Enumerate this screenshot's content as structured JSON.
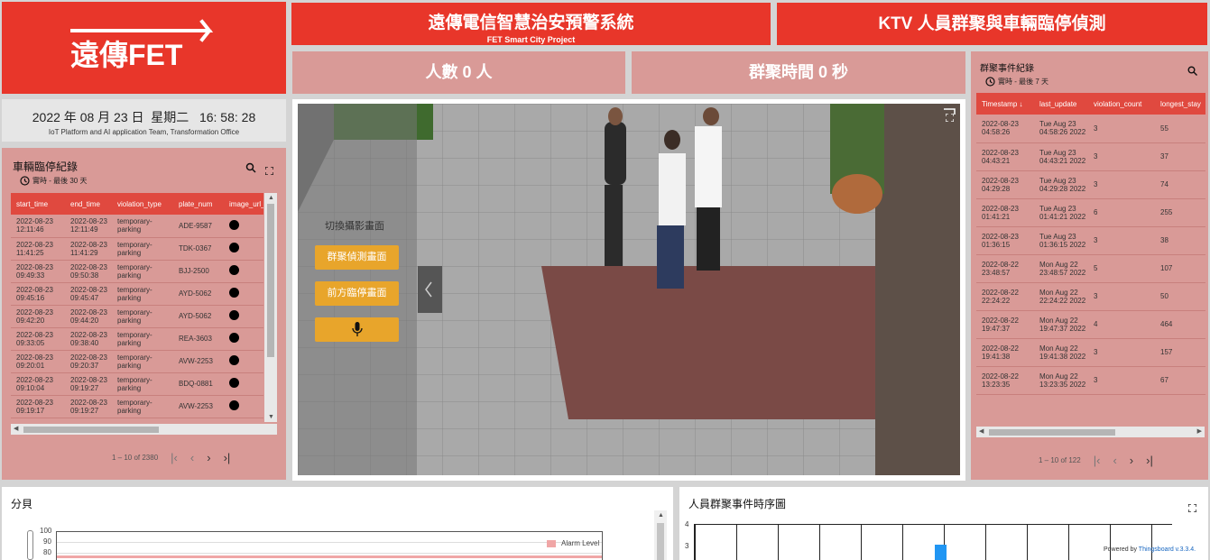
{
  "header": {
    "title": "遠傳電信智慧治安預警系統",
    "subtitle": "FET Smart City Project",
    "right_title": "KTV 人員群聚與車輛臨停偵測",
    "logo_text": "遠傳FET"
  },
  "stats": {
    "people": "人數 0 人",
    "gather_time": "群聚時間 0 秒"
  },
  "clock": {
    "datetime": "2022 年 08 月 23 日  星期二   16: 58: 28",
    "org": "IoT Platform and AI application Team, Transformation Office"
  },
  "parking": {
    "title": "車輛臨停紀錄",
    "range": "實時 - 最後 30 天",
    "columns": [
      "start_time",
      "end_time",
      "violation_type",
      "plate_num",
      "image_url_"
    ],
    "rows": [
      {
        "start": "2022-08-23 12:11:46",
        "end": "2022-08-23 12:11:49",
        "type": "temporary-parking",
        "plate": "ADE-9587"
      },
      {
        "start": "2022-08-23 11:41:25",
        "end": "2022-08-23 11:41:29",
        "type": "temporary-parking",
        "plate": "TDK-0367"
      },
      {
        "start": "2022-08-23 09:49:33",
        "end": "2022-08-23 09:50:38",
        "type": "temporary-parking",
        "plate": "BJJ-2500"
      },
      {
        "start": "2022-08-23 09:45:16",
        "end": "2022-08-23 09:45:47",
        "type": "temporary-parking",
        "plate": "AYD-5062"
      },
      {
        "start": "2022-08-23 09:42:20",
        "end": "2022-08-23 09:44:20",
        "type": "temporary-parking",
        "plate": "AYD-5062"
      },
      {
        "start": "2022-08-23 09:33:05",
        "end": "2022-08-23 09:38:40",
        "type": "temporary-parking",
        "plate": "REA-3603"
      },
      {
        "start": "2022-08-23 09:20:01",
        "end": "2022-08-23 09:20:37",
        "type": "temporary-parking",
        "plate": "AVW-2253"
      },
      {
        "start": "2022-08-23 09:10:04",
        "end": "2022-08-23 09:19:27",
        "type": "temporary-parking",
        "plate": "BDQ-0881"
      },
      {
        "start": "2022-08-23 09:19:17",
        "end": "2022-08-23 09:19:27",
        "type": "temporary-parking",
        "plate": "AVW-2253"
      }
    ],
    "pagination": "1 – 10 of 2380"
  },
  "camera": {
    "switch_label": "切換攝影畫面",
    "btn_gather": "群聚偵測畫面",
    "btn_front": "前方臨停畫面"
  },
  "events": {
    "title": "群聚事件紀錄",
    "range": "實時 - 最後 7 天",
    "columns": [
      "Timestamp",
      "last_update",
      "violation_count",
      "longest_stay"
    ],
    "rows": [
      {
        "ts": "2022-08-23 04:58:26",
        "upd": "Tue Aug 23 04:58:26 2022",
        "count": "3",
        "stay": "55"
      },
      {
        "ts": "2022-08-23 04:43:21",
        "upd": "Tue Aug 23 04:43:21 2022",
        "count": "3",
        "stay": "37"
      },
      {
        "ts": "2022-08-23 04:29:28",
        "upd": "Tue Aug 23 04:29:28 2022",
        "count": "3",
        "stay": "74"
      },
      {
        "ts": "2022-08-23 01:41:21",
        "upd": "Tue Aug 23 01:41:21 2022",
        "count": "6",
        "stay": "255"
      },
      {
        "ts": "2022-08-23 01:36:15",
        "upd": "Tue Aug 23 01:36:15 2022",
        "count": "3",
        "stay": "38"
      },
      {
        "ts": "2022-08-22 23:48:57",
        "upd": "Mon Aug 22 23:48:57 2022",
        "count": "5",
        "stay": "107"
      },
      {
        "ts": "2022-08-22 22:24:22",
        "upd": "Mon Aug 22 22:24:22 2022",
        "count": "3",
        "stay": "50"
      },
      {
        "ts": "2022-08-22 19:47:37",
        "upd": "Mon Aug 22 19:47:37 2022",
        "count": "4",
        "stay": "464"
      },
      {
        "ts": "2022-08-22 19:41:38",
        "upd": "Mon Aug 22 19:41:38 2022",
        "count": "3",
        "stay": "157"
      },
      {
        "ts": "2022-08-22 13:23:35",
        "upd": "Mon Aug 22 13:23:35 2022",
        "count": "3",
        "stay": "67"
      }
    ],
    "pagination": "1 – 10 of 122"
  },
  "decibel": {
    "title": "分貝",
    "ticks": [
      "100",
      "90",
      "80"
    ],
    "legend": "Alarm Level"
  },
  "timeline": {
    "title": "人員群聚事件時序圖",
    "ticks": [
      "4",
      "3"
    ],
    "powered": "Powered by ",
    "powered_link": "Thingsboard v.3.3.4."
  },
  "colors": {
    "brand_red": "#e8362a",
    "panel_pink": "#d99a97",
    "button_orange": "#e8a52b"
  }
}
